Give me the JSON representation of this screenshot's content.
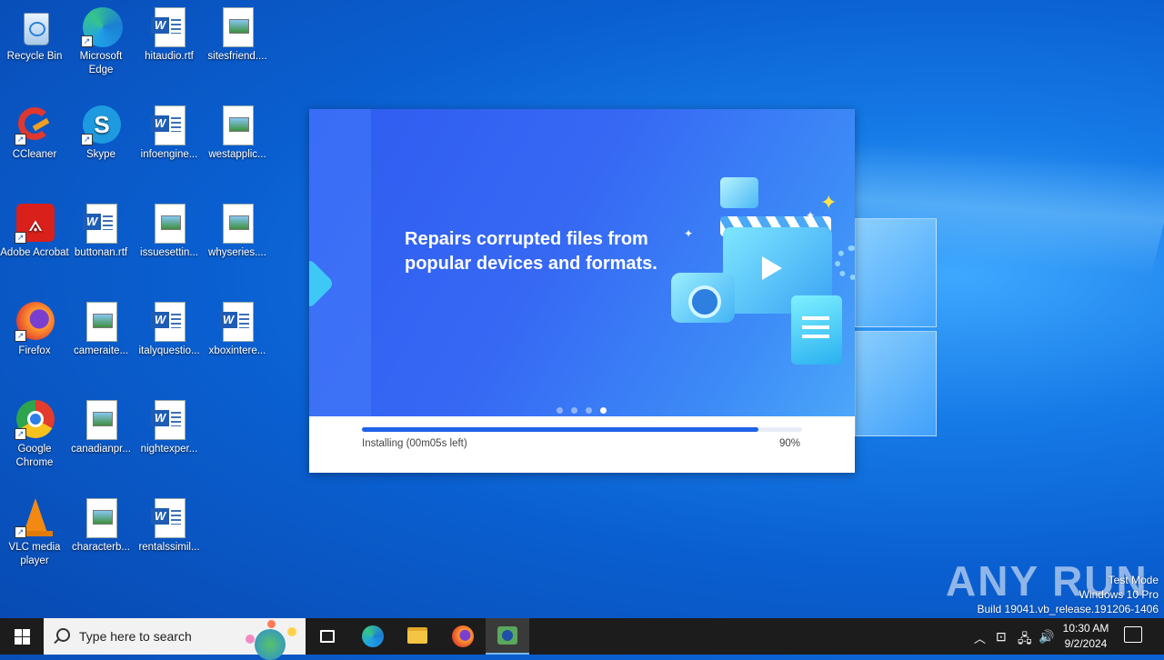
{
  "desktop": {
    "icons": [
      {
        "label": "Recycle Bin"
      },
      {
        "label": "Microsoft Edge"
      },
      {
        "label": "hitaudio.rtf"
      },
      {
        "label": "sitesfriend...."
      },
      {
        "label": "CCleaner"
      },
      {
        "label": "Skype"
      },
      {
        "label": "infoengine..."
      },
      {
        "label": "westapplic..."
      },
      {
        "label": "Adobe Acrobat"
      },
      {
        "label": "buttonan.rtf"
      },
      {
        "label": "issuesettin..."
      },
      {
        "label": "whyseries...."
      },
      {
        "label": "Firefox"
      },
      {
        "label": "cameraite..."
      },
      {
        "label": "italyquestio..."
      },
      {
        "label": "xboxintere..."
      },
      {
        "label": "Google Chrome"
      },
      {
        "label": "canadianpr..."
      },
      {
        "label": "nightexper..."
      },
      {
        "label": "VLC media player"
      },
      {
        "label": "characterb..."
      },
      {
        "label": "rentalssimil..."
      }
    ]
  },
  "installer": {
    "slogan": "Repairs corrupted files from popular devices and formats.",
    "slide_count": 4,
    "active_slide": 4,
    "progress": 0.9,
    "status_text": "Installing (00m05s left)",
    "percent_text": "90%",
    "accent": "#1f63e8"
  },
  "watermark": {
    "brand": "ANY RUN",
    "line1": "Test Mode",
    "line2": "Windows 10 Pro",
    "line3": "Build 19041.vb_release.191206-1406"
  },
  "taskbar": {
    "search_placeholder": "Type here to search",
    "clock_time": "10:30 AM",
    "clock_date": "9/2/2024",
    "pinned": [
      "task-view-icon",
      "edge-icon",
      "file-explorer-icon",
      "firefox-icon",
      "installer-icon"
    ]
  }
}
